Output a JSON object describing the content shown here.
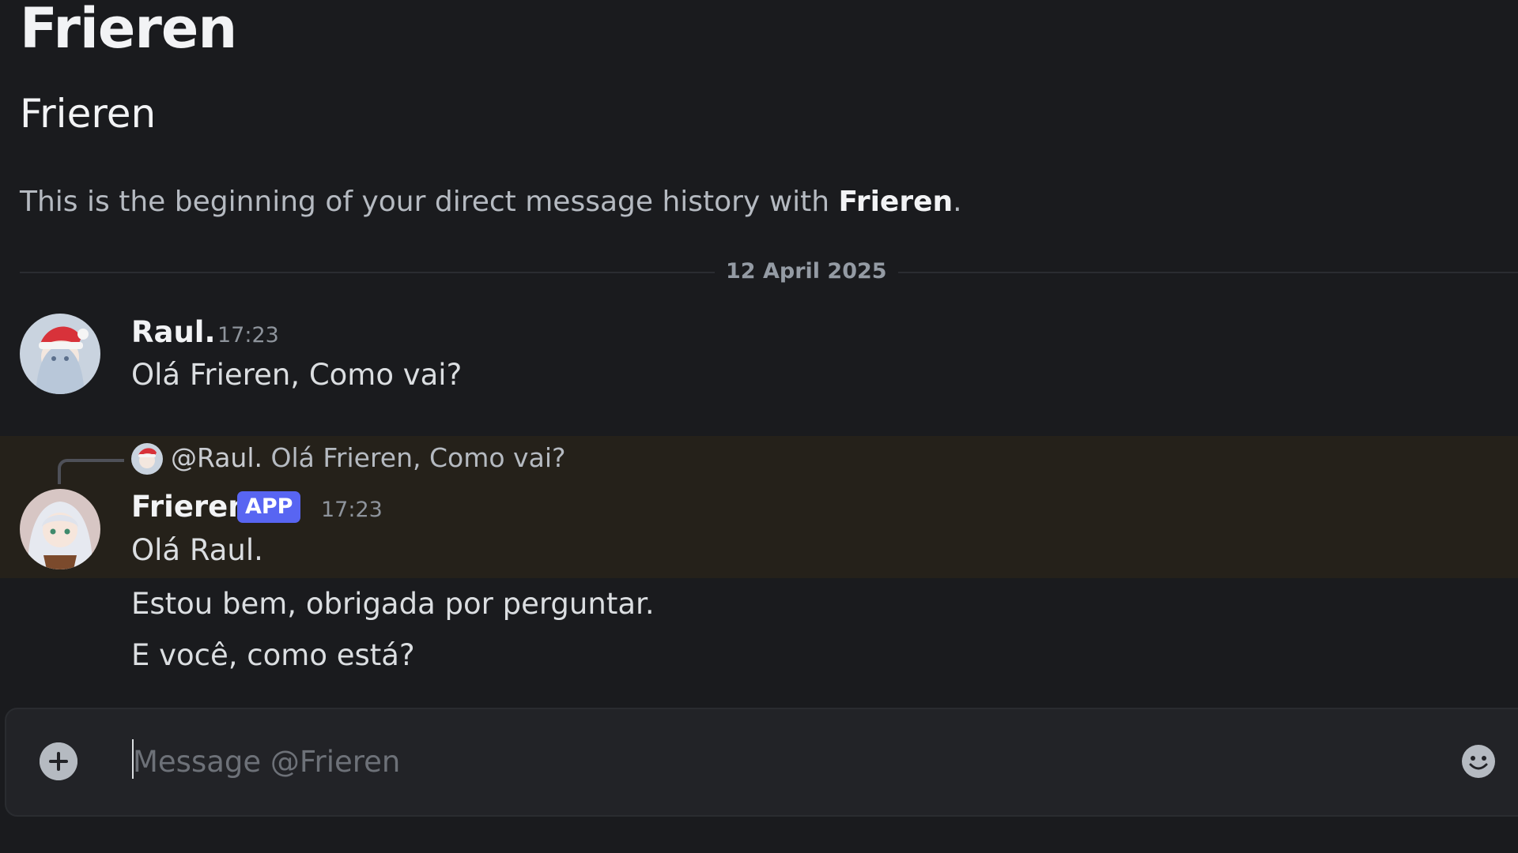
{
  "header": {
    "title": "Frieren",
    "subtitle": "Frieren"
  },
  "intro": {
    "text_before": "This is the beginning of your direct message history with ",
    "name": "Frieren",
    "text_after": "."
  },
  "date_divider": "12 April 2025",
  "messages": [
    {
      "author": "Raul.",
      "timestamp": "17:23",
      "avatar_icon": "santa-hat-avatar-icon",
      "lines": [
        "Olá Frieren, Como vai?"
      ]
    },
    {
      "author": "Frieren",
      "badge": "APP",
      "timestamp": "17:23",
      "avatar_icon": "frieren-avatar-icon",
      "reply": {
        "mention": "@Raul.",
        "text": " Olá Frieren, Como vai?"
      },
      "lines": [
        "Olá Raul.",
        "Estou bem, obrigada por perguntar.",
        "E você, como está?"
      ]
    }
  ],
  "composer": {
    "placeholder": "Message @Frieren",
    "value": "",
    "attach_icon": "plus-circle-icon",
    "emoji_icon": "smiley-icon"
  },
  "colors": {
    "background": "#1a1b1e",
    "highlight": "#25211a",
    "badge": "#5865f2",
    "composer": "#222327"
  }
}
